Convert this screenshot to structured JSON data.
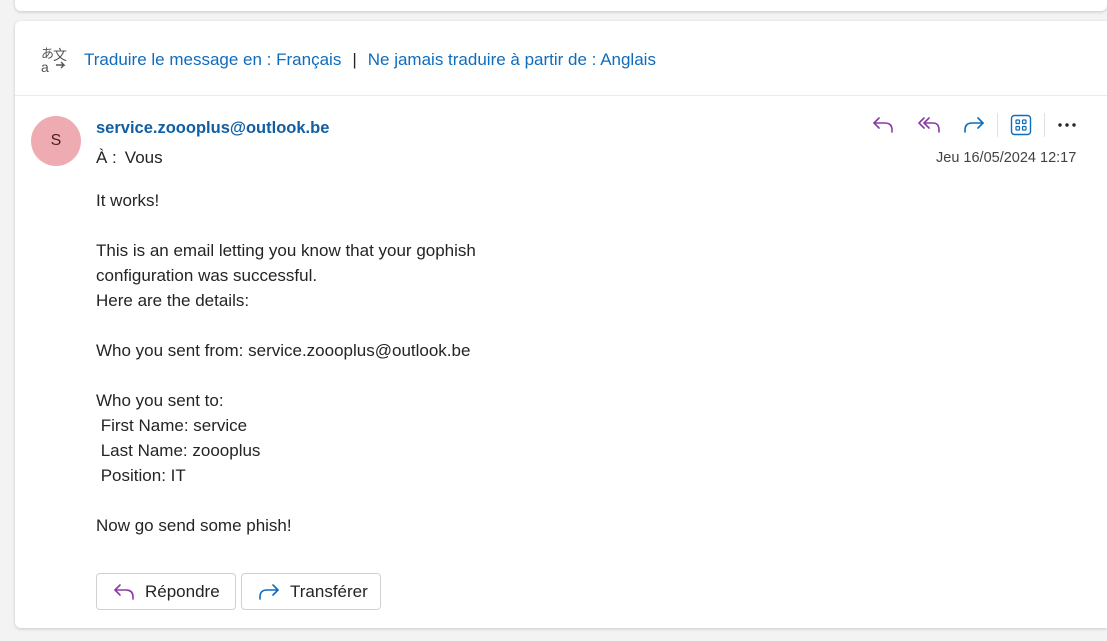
{
  "translate": {
    "translate_to": "Traduire le message en : Français",
    "separator": "|",
    "never_translate": "Ne jamais traduire à partir de : Anglais"
  },
  "message": {
    "avatar_initial": "S",
    "sender": "service.zoooplus@outlook.be",
    "to_label": "À :",
    "to_value": "Vous",
    "date": "Jeu 16/05/2024 12:17",
    "body": "It works!\n\nThis is an email letting you know that your gophish\nconfiguration was successful.\nHere are the details:\n\nWho you sent from: service.zoooplus@outlook.be\n\nWho you sent to:\n First Name: service\n Last Name: zoooplus\n Position: IT\n\nNow go send some phish!"
  },
  "buttons": {
    "reply": "Répondre",
    "forward": "Transférer"
  },
  "icons": {
    "translate": "translate-icon",
    "reply": "reply-icon",
    "reply_all": "reply-all-icon",
    "forward": "forward-icon",
    "apps": "apps-icon",
    "more": "more-icon"
  },
  "colors": {
    "link": "#0f6cbd",
    "sender": "#115ea3",
    "reply_purple": "#8a3aa8",
    "forward_blue": "#0f6cbd",
    "avatar_bg": "#eeacb2"
  }
}
